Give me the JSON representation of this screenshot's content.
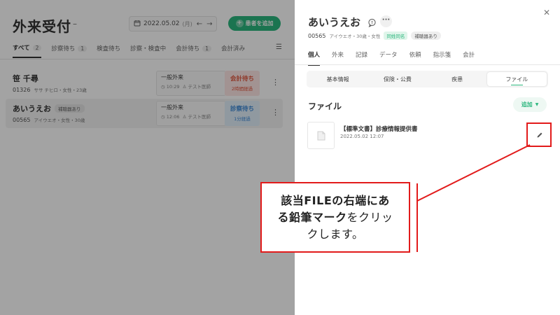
{
  "reception": {
    "title": "外来受付",
    "title_suffix": "–",
    "date": "2022.05.02",
    "weekday": "(月)",
    "prev_icon": "arrow-left-icon",
    "next_icon": "arrow-right-icon",
    "add_patient_label": "患者を追加",
    "tabs": [
      {
        "label": "すべて",
        "count": "2"
      },
      {
        "label": "診察待ち",
        "count": "1"
      },
      {
        "label": "検査待ち",
        "count": ""
      },
      {
        "label": "診察・検査中",
        "count": ""
      },
      {
        "label": "会計待ち",
        "count": "1"
      },
      {
        "label": "会計済み",
        "count": ""
      }
    ],
    "patients": [
      {
        "name": "笹 千尋",
        "badge": "",
        "id": "01326",
        "meta": "ササ チヒロ・女性・23歳",
        "visit_type": "一般外来",
        "time": "10:29",
        "doctor": "テスト医師",
        "status": "会計待ち",
        "elapsed": "2時間経過",
        "status_color": "#e0563f"
      },
      {
        "name": "あいうえお",
        "badge": "補聴器あり",
        "id": "00565",
        "meta": "アイウエオ・女性・30歳",
        "visit_type": "一般外来",
        "time": "12:06",
        "doctor": "テスト医師",
        "status": "診察待ち",
        "elapsed": "1分経過",
        "status_color": "#3f8ad6"
      }
    ]
  },
  "drawer": {
    "patient_name": "あいうえお",
    "patient_id": "00565",
    "patient_meta": "アイウエオ・30歳・女性",
    "badge_same_name": "同姓同名",
    "badge_hearing": "補聴器あり",
    "tabs": [
      "個人",
      "外来",
      "記録",
      "データ",
      "依頼",
      "指示箋",
      "会計"
    ],
    "active_tab": "個人",
    "subtabs": [
      "基本情報",
      "保険・公費",
      "疾患",
      "ファイル"
    ],
    "active_subtab": "ファイル",
    "section_title": "ファイル",
    "add_label": "追加",
    "file": {
      "title": "【標準文書】診療情報提供書",
      "date": "2022.05.02 12:07"
    }
  },
  "callout": {
    "line1_bold": "該当FILEの右端にあ",
    "line2_bold": "る鉛筆マーク",
    "line2_rest": "をクリッ",
    "line3": "クします。"
  },
  "colors": {
    "accent_green": "#2bb67d",
    "annotation_red": "#e21b1b"
  }
}
